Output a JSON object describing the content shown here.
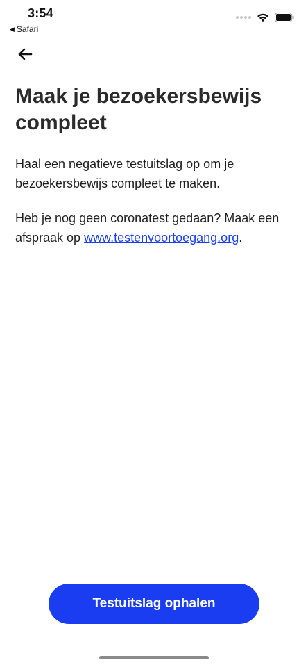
{
  "status_bar": {
    "time": "3:54",
    "back_app_label": "Safari",
    "icons": [
      "signal-dots",
      "wifi-icon",
      "battery-icon"
    ]
  },
  "nav": {
    "back_icon": "arrow-left-icon"
  },
  "content": {
    "title": "Maak je bezoekersbewijs compleet",
    "paragraph1": "Haal een negatieve testuitslag op om je bezoekersbewijs compleet te maken.",
    "paragraph2_prefix": "Heb je nog geen coronatest gedaan? Maak een afspraak op ",
    "paragraph2_link": "www.testenvoortoegang.org",
    "paragraph2_suffix": "."
  },
  "actions": {
    "primary_button_label": "Testuitslag ophalen"
  },
  "colors": {
    "accent": "#1b3df2",
    "link": "#1a3ef0",
    "text": "#1f1f1f"
  }
}
